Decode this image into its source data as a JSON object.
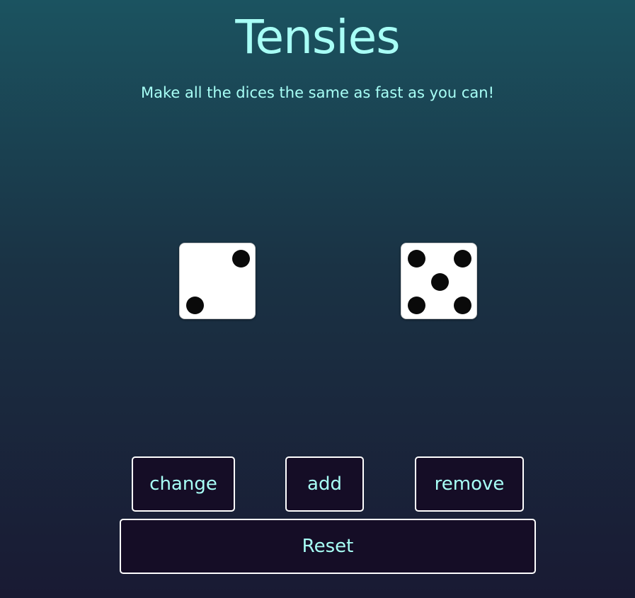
{
  "header": {
    "title": "Tensies",
    "subtitle": "Make all the dices the same as fast as you can!"
  },
  "dice": [
    {
      "value": 2
    },
    {
      "value": 5
    }
  ],
  "controls": {
    "change_label": "change",
    "add_label": "add",
    "remove_label": "remove",
    "reset_label": "Reset"
  },
  "colors": {
    "accent_text": "#a8fff6",
    "button_bg": "#150d26",
    "button_border": "#ffffff",
    "die_face": "#ffffff",
    "pip": "#0a0a0a"
  }
}
